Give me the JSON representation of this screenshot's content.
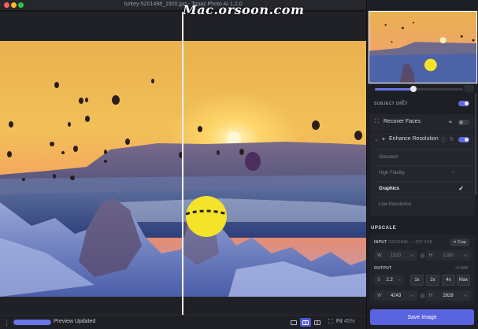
{
  "window": {
    "title": "turkey-5201498_1920.jpg - Topaz Photo AI 1.2.0",
    "watermark": "Mac.orsoon.com"
  },
  "status_bar": {
    "menu_glyph": "⋮",
    "progress_percent": 100,
    "status": "Preview Updated",
    "fit_label": "Fit",
    "zoom": "45%"
  },
  "panel": {
    "slider_percent": 44,
    "subject_only": {
      "label": "SUBJECT ONLY",
      "enabled": true
    },
    "recover_faces": {
      "label": "Recover Faces",
      "enabled": false
    },
    "enhance_resolution": {
      "label": "Enhance Resolution",
      "enabled": true,
      "models": [
        "Standard",
        "High Fidelity",
        "Graphics",
        "Low Resolution"
      ],
      "selected_model": "Graphics"
    },
    "upscale": {
      "heading": "UPSCALE",
      "input_label": "INPUT",
      "input_note": "ORIGINAL · ~297.5KB",
      "crop_label": "Crop",
      "input_w_label": "W",
      "input_w": "1920",
      "input_h_label": "H",
      "input_h": "1280",
      "unit": "PX",
      "output_label": "OUTPUT",
      "output_note": "~6.0MB",
      "scale_label": "S",
      "scale": "2.2",
      "scale_unit": "X",
      "presets": [
        "1x",
        "2x",
        "4x",
        "Max"
      ],
      "output_w_label": "W",
      "output_w": "4243",
      "output_h_label": "H",
      "output_h": "2828"
    },
    "save_label": "Save Image"
  },
  "colors": {
    "accent": "#5a63e0",
    "panel_bg": "#1e1f24",
    "canvas_bg": "#202127"
  }
}
